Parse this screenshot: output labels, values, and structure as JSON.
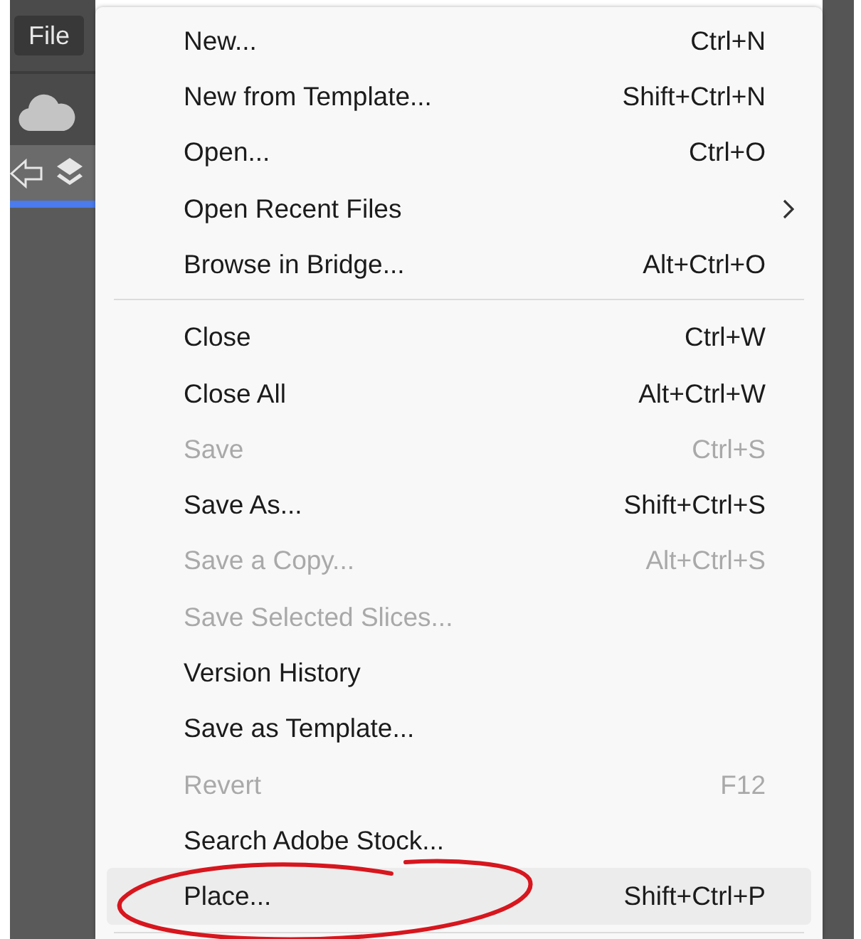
{
  "menu_bar": [
    {
      "label": "File"
    }
  ],
  "menu": [
    {
      "kind": "item",
      "label": "New...",
      "shortcut": "Ctrl+N",
      "disabled": false,
      "submenu": false,
      "highlighted": false
    },
    {
      "kind": "item",
      "label": "New from Template...",
      "shortcut": "Shift+Ctrl+N",
      "disabled": false,
      "submenu": false,
      "highlighted": false
    },
    {
      "kind": "item",
      "label": "Open...",
      "shortcut": "Ctrl+O",
      "disabled": false,
      "submenu": false,
      "highlighted": false
    },
    {
      "kind": "item",
      "label": "Open Recent Files",
      "disabled": false,
      "submenu": true,
      "highlighted": false
    },
    {
      "kind": "item",
      "label": "Browse in Bridge...",
      "shortcut": "Alt+Ctrl+O",
      "disabled": false,
      "submenu": false,
      "highlighted": false
    },
    {
      "kind": "separator"
    },
    {
      "kind": "item",
      "label": "Close",
      "shortcut": "Ctrl+W",
      "disabled": false,
      "submenu": false,
      "highlighted": false
    },
    {
      "kind": "item",
      "label": "Close All",
      "shortcut": "Alt+Ctrl+W",
      "disabled": false,
      "submenu": false,
      "highlighted": false
    },
    {
      "kind": "item",
      "label": "Save",
      "shortcut": "Ctrl+S",
      "disabled": true,
      "submenu": false,
      "highlighted": false
    },
    {
      "kind": "item",
      "label": "Save As...",
      "shortcut": "Shift+Ctrl+S",
      "disabled": false,
      "submenu": false,
      "highlighted": false
    },
    {
      "kind": "item",
      "label": "Save a Copy...",
      "shortcut": "Alt+Ctrl+S",
      "disabled": true,
      "submenu": false,
      "highlighted": false
    },
    {
      "kind": "item",
      "label": "Save Selected Slices...",
      "disabled": true,
      "submenu": false,
      "highlighted": false
    },
    {
      "kind": "item",
      "label": "Version History",
      "disabled": false,
      "submenu": false,
      "highlighted": false
    },
    {
      "kind": "item",
      "label": "Save as Template...",
      "disabled": false,
      "submenu": false,
      "highlighted": false
    },
    {
      "kind": "item",
      "label": "Revert",
      "shortcut": "F12",
      "disabled": true,
      "submenu": false,
      "highlighted": false
    },
    {
      "kind": "item",
      "label": "Search Adobe Stock...",
      "disabled": false,
      "submenu": false,
      "highlighted": false
    },
    {
      "kind": "item",
      "label": "Place...",
      "shortcut": "Shift+Ctrl+P",
      "disabled": false,
      "submenu": false,
      "highlighted": true
    },
    {
      "kind": "separator"
    }
  ]
}
